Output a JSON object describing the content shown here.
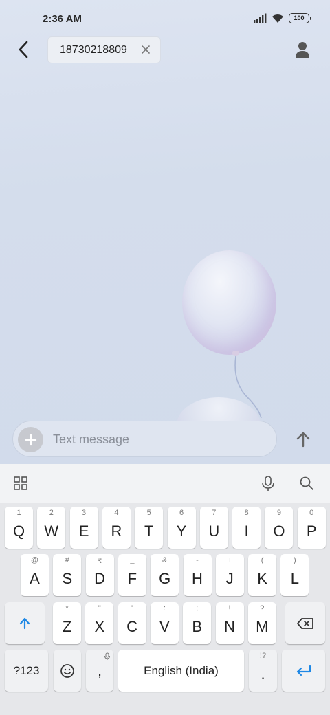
{
  "status_bar": {
    "time": "2:36 AM",
    "battery": "100",
    "icons": [
      "signal-icon",
      "wifi-icon",
      "battery-icon"
    ]
  },
  "header": {
    "recipient": "18730218809",
    "icons": [
      "back-arrow-icon",
      "close-icon",
      "contact-icon"
    ]
  },
  "compose": {
    "placeholder": "Text message",
    "icons": [
      "plus-icon",
      "send-arrow-icon"
    ]
  },
  "keyboard": {
    "toolbar_icons": [
      "apps-grid-icon",
      "microphone-icon",
      "search-icon"
    ],
    "row1": [
      {
        "label": "Q",
        "hint": "1"
      },
      {
        "label": "W",
        "hint": "2"
      },
      {
        "label": "E",
        "hint": "3"
      },
      {
        "label": "R",
        "hint": "4"
      },
      {
        "label": "T",
        "hint": "5"
      },
      {
        "label": "Y",
        "hint": "6"
      },
      {
        "label": "U",
        "hint": "7"
      },
      {
        "label": "I",
        "hint": "8"
      },
      {
        "label": "O",
        "hint": "9"
      },
      {
        "label": "P",
        "hint": "0"
      }
    ],
    "row2": [
      {
        "label": "A",
        "hint": "@"
      },
      {
        "label": "S",
        "hint": "#"
      },
      {
        "label": "D",
        "hint": "₹"
      },
      {
        "label": "F",
        "hint": "_"
      },
      {
        "label": "G",
        "hint": "&"
      },
      {
        "label": "H",
        "hint": "-"
      },
      {
        "label": "J",
        "hint": "+"
      },
      {
        "label": "K",
        "hint": "("
      },
      {
        "label": "L",
        "hint": ")"
      }
    ],
    "row3": [
      {
        "label": "Z",
        "hint": "*"
      },
      {
        "label": "X",
        "hint": "\""
      },
      {
        "label": "C",
        "hint": "'"
      },
      {
        "label": "V",
        "hint": ":"
      },
      {
        "label": "B",
        "hint": ";"
      },
      {
        "label": "N",
        "hint": "!"
      },
      {
        "label": "M",
        "hint": "?"
      }
    ],
    "symbols_label": "?123",
    "comma_label": ",",
    "space_label": "English (India)",
    "period_label": ".",
    "period_hint": "!?",
    "accent_color": "#1e88e5"
  }
}
